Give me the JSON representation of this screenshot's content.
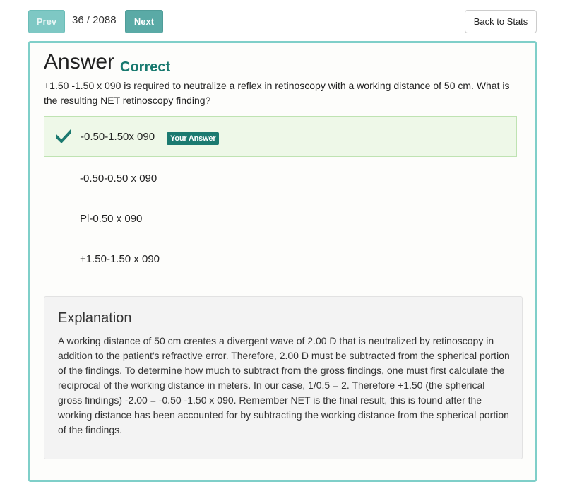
{
  "nav": {
    "prev_label": "Prev",
    "counter": "36 / 2088",
    "next_label": "Next",
    "back_label": "Back to Stats"
  },
  "answer": {
    "title": "Answer",
    "status": "Correct",
    "status_color": "#18796f",
    "question": "+1.50 -1.50 x 090 is required to neutralize a reflex in retinoscopy with a working distance of 50 cm. What is the resulting NET retinoscopy finding?",
    "options": [
      {
        "text": "-0.50-1.50x 090",
        "selected": true,
        "badge": "Your Answer",
        "icon": "checkmark-icon"
      },
      {
        "text": "-0.50-0.50 x 090",
        "selected": false
      },
      {
        "text": "Pl-0.50 x 090",
        "selected": false
      },
      {
        "text": "+1.50-1.50 x 090",
        "selected": false
      }
    ]
  },
  "explanation": {
    "title": "Explanation",
    "text": "A working distance of 50 cm creates a divergent wave of 2.00 D that is neutralized by retinoscopy in addition to the patient's refractive error. Therefore, 2.00 D must be subtracted from the spherical portion of the findings. To determine how much to subtract from the gross findings, one must first calculate the reciprocal of the working distance in meters. In our case, 1/0.5 = 2. Therefore +1.50 (the spherical gross findings) -2.00 = -0.50 -1.50 x 090. Remember NET is the final result, this is found after the working distance has been accounted for by subtracting the working distance from the spherical portion of the findings."
  },
  "colors": {
    "accent": "#7fcfc9",
    "button_teal": "#5aaaa6",
    "badge": "#1b7a70",
    "selected_bg": "#eef8e8"
  }
}
